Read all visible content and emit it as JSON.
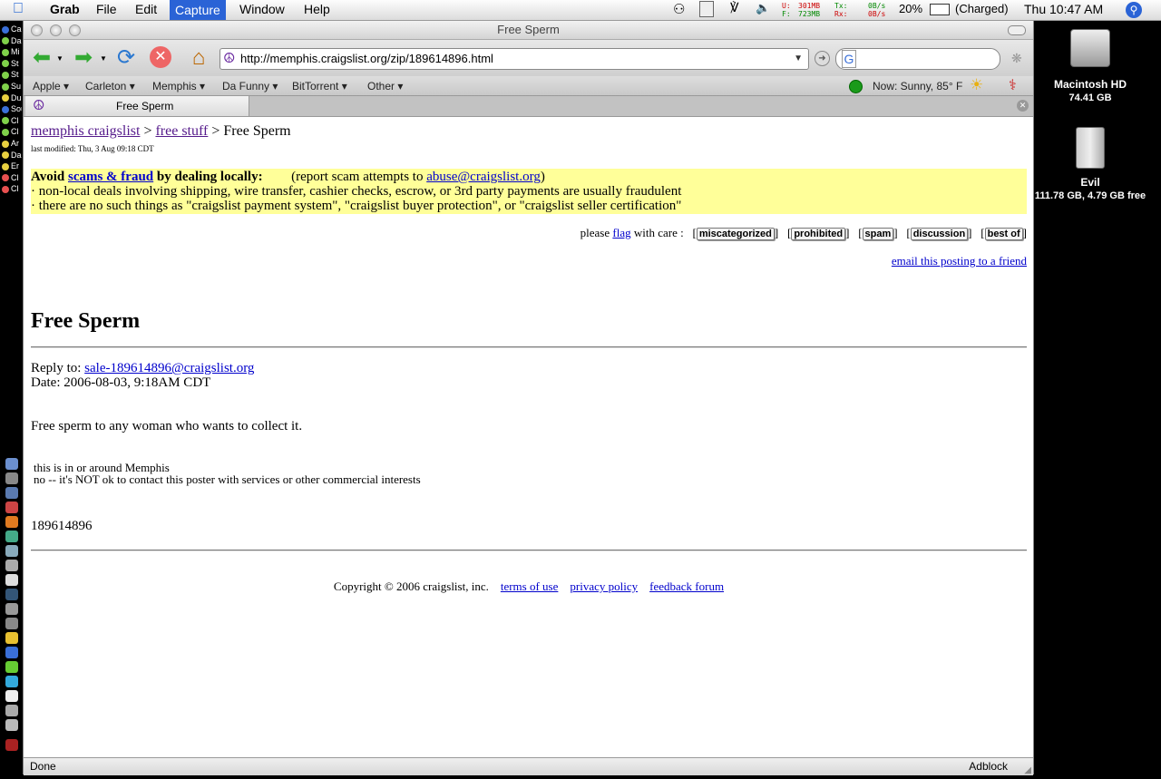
{
  "menubar": {
    "app": "Grab",
    "items": [
      "File",
      "Edit",
      "Capture",
      "Window",
      "Help"
    ],
    "active": "Capture",
    "mem_u_label": "U:",
    "mem_u": "301MB",
    "mem_f_label": "F:",
    "mem_f": "723MB",
    "net_tx_label": "Tx:",
    "net_tx": "0B/s",
    "net_rx_label": "Rx:",
    "net_rx": "0B/s",
    "battery_pct": "20%",
    "battery_status": "(Charged)",
    "clock": "Thu 10:47 AM"
  },
  "left_strip": {
    "items": [
      {
        "label": "Car",
        "color": "#3a6fd8"
      },
      {
        "label": "Da",
        "color": "#7fd14a"
      },
      {
        "label": "Mi",
        "color": "#7fd14a"
      },
      {
        "label": "St",
        "color": "#7fd14a"
      },
      {
        "label": "St",
        "color": "#7fd14a"
      },
      {
        "label": "Su",
        "color": "#7fd14a"
      },
      {
        "label": "Du",
        "color": "#e8d040"
      },
      {
        "label": "Sou",
        "color": "#3a6fd8"
      },
      {
        "label": "Cl",
        "color": "#7fd14a"
      },
      {
        "label": "Cl",
        "color": "#7fd14a"
      },
      {
        "label": "Ar",
        "color": "#e8d040"
      },
      {
        "label": "Da",
        "color": "#e8d040"
      },
      {
        "label": "Er",
        "color": "#e8d040"
      },
      {
        "label": "Cl",
        "color": "#e85050"
      },
      {
        "label": "Cl",
        "color": "#e85050"
      }
    ]
  },
  "window": {
    "title": "Free Sperm"
  },
  "toolbar": {
    "url": "http://memphis.craigslist.org/zip/189614896.html",
    "search_engine": "G"
  },
  "bookmarks": [
    "Apple",
    "Carleton",
    "Memphis",
    "Da Funny",
    "BitTorrent",
    "Other"
  ],
  "weather": "Now: Sunny, 85° F",
  "tab": {
    "label": "Free Sperm"
  },
  "page": {
    "breadcrumb": {
      "home": "memphis craigslist",
      "sep1": " > ",
      "category": "free stuff",
      "sep2": " > ",
      "current": "Free Sperm"
    },
    "last_modified": "last modified: Thu, 3 Aug 09:18 CDT",
    "warning": {
      "avoid": "Avoid",
      "scams_link": "scams & fraud",
      "by_dealing": "by dealing locally:",
      "report_prefix": "(report scam attempts to",
      "abuse_link": "abuse@craigslist.org",
      "report_suffix": ")",
      "line1": "· non-local deals involving shipping, wire transfer, cashier checks, escrow, or 3rd party payments are usually fraudulent",
      "line2": "· there are no such things as \"craigslist payment system\", \"craigslist buyer protection\", or \"craigslist seller certification\""
    },
    "flag": {
      "prefix": "please",
      "flag_link": "flag",
      "suffix": "with care :",
      "buttons": [
        "miscategorized",
        "prohibited",
        "spam",
        "discussion",
        "best of"
      ]
    },
    "email_friend": "email this posting to a friend",
    "title": "Free Sperm",
    "reply_label": "Reply to:",
    "reply_email": "sale-189614896@craigslist.org",
    "date_line": "Date: 2006-08-03, 9:18AM CDT",
    "body": "Free sperm to any woman who wants to collect it.",
    "location": "this is in or around Memphis",
    "contact_policy": "no -- it's NOT ok to contact this poster with services or other commercial interests",
    "post_id": "189614896",
    "footer": {
      "copyright": "Copyright © 2006 craigslist, inc.",
      "links": [
        "terms of use",
        "privacy policy",
        "feedback forum"
      ]
    }
  },
  "statusbar": {
    "status": "Done",
    "adblock": "Adblock"
  },
  "desktop": {
    "drives": [
      {
        "name": "Macintosh HD",
        "info": "74.41 GB"
      },
      {
        "name": "Evil",
        "info": "111.78 GB, 4.79 GB free"
      }
    ]
  }
}
